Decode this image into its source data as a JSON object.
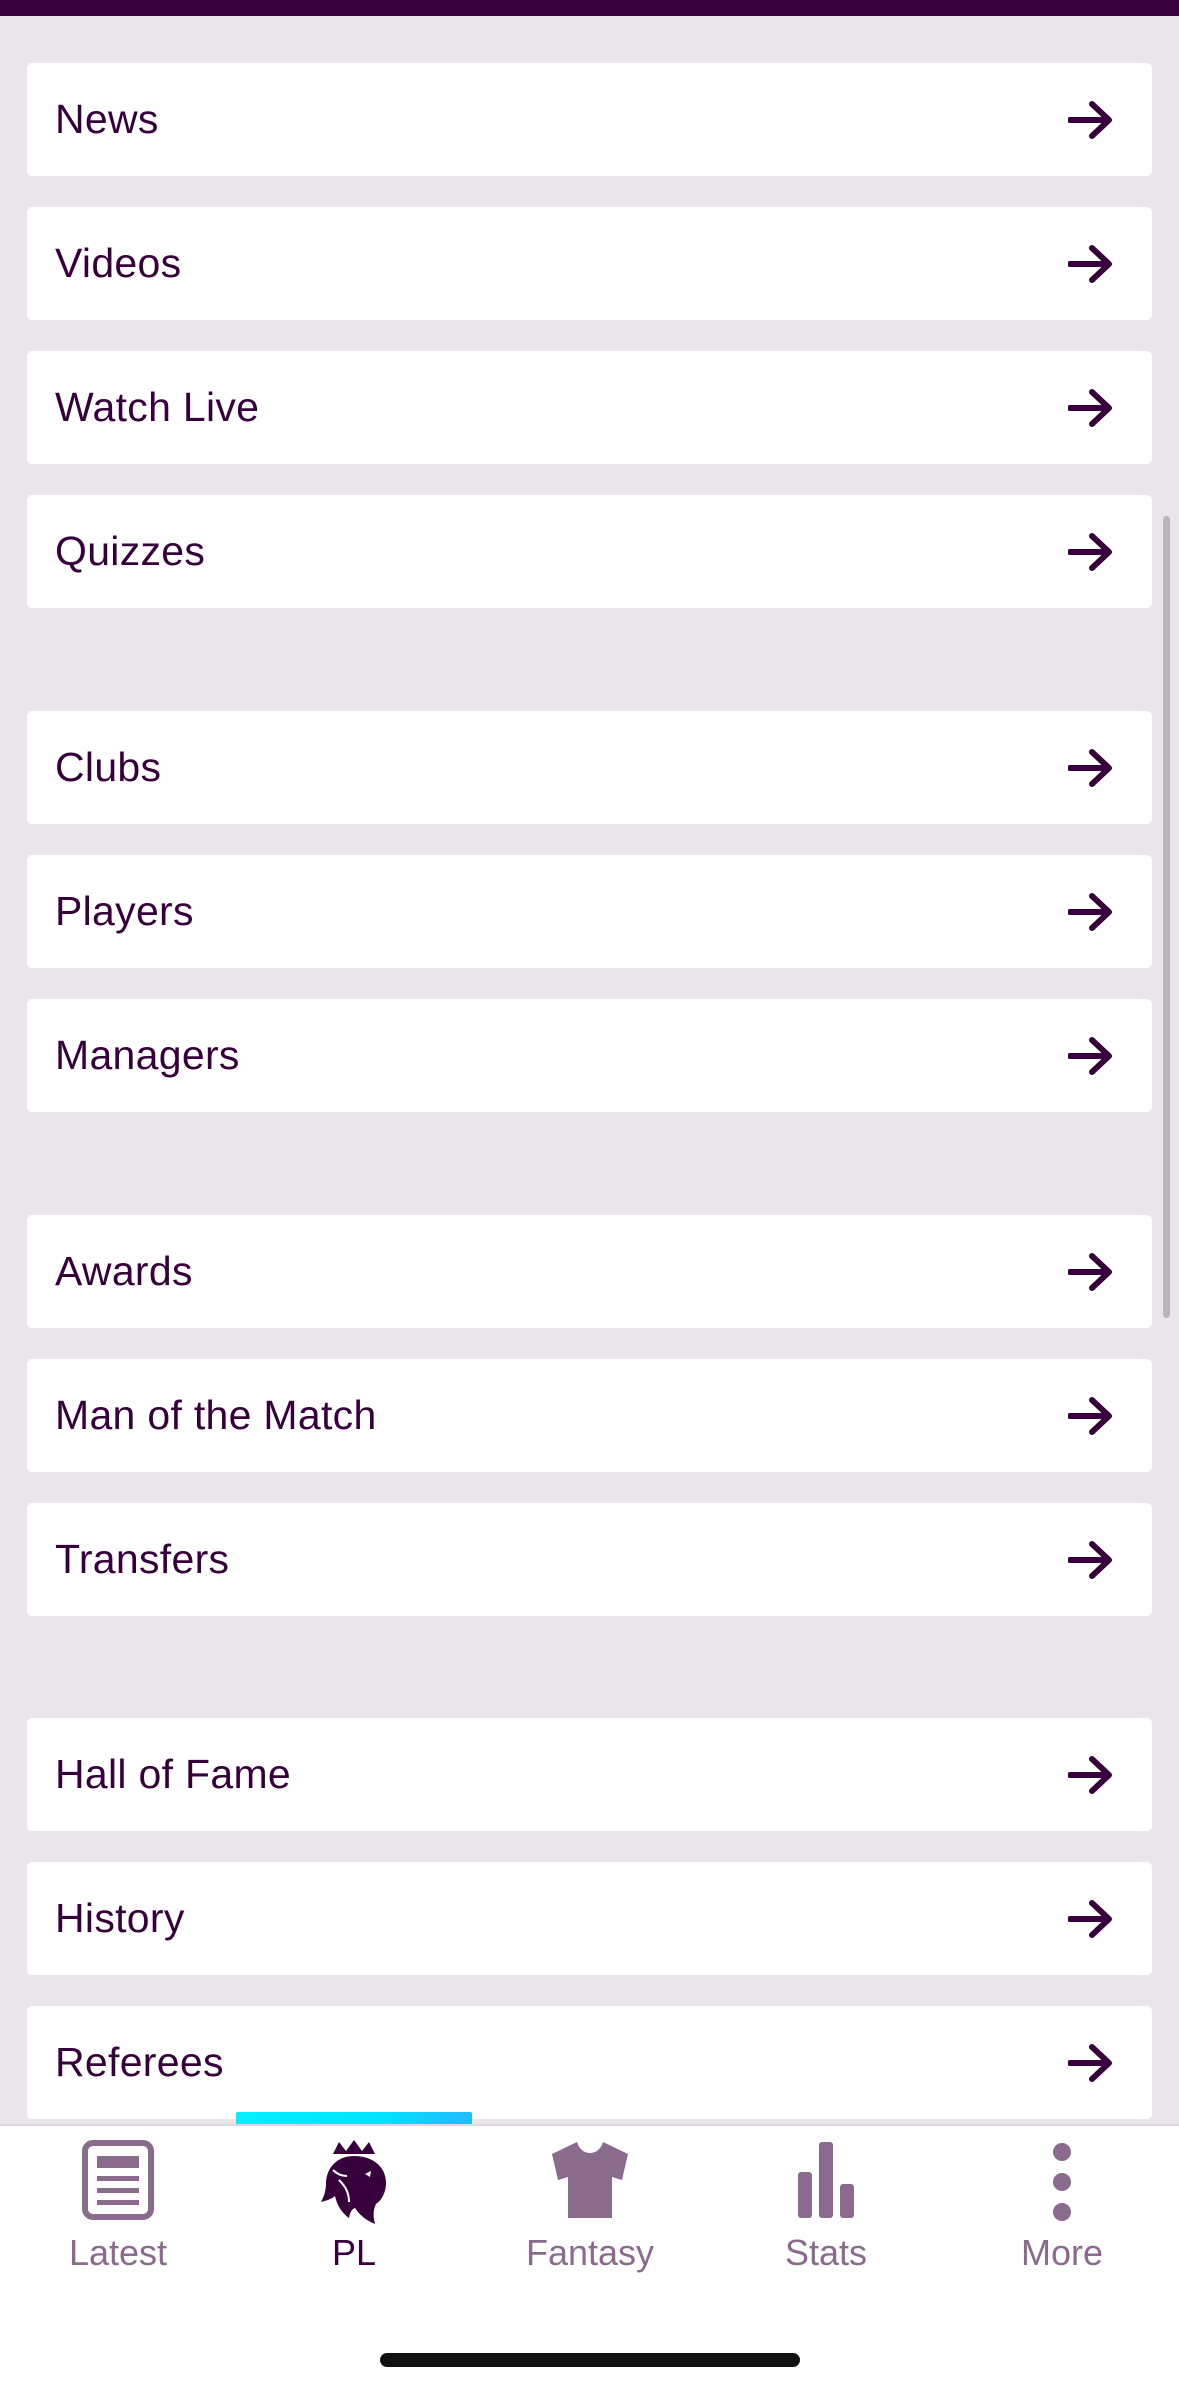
{
  "menu": {
    "items": [
      {
        "label": "News"
      },
      {
        "label": "Videos"
      },
      {
        "label": "Watch Live"
      },
      {
        "label": "Quizzes"
      },
      {
        "label": "Clubs"
      },
      {
        "label": "Players"
      },
      {
        "label": "Managers"
      },
      {
        "label": "Awards"
      },
      {
        "label": "Man of the Match"
      },
      {
        "label": "Transfers"
      },
      {
        "label": "Hall of Fame"
      },
      {
        "label": "History"
      },
      {
        "label": "Referees"
      }
    ],
    "arrow_icon": "arrow-right-icon"
  },
  "tabs": [
    {
      "label": "Latest",
      "icon": "news-article-icon",
      "active": false
    },
    {
      "label": "PL",
      "icon": "premier-league-lion-icon",
      "active": true
    },
    {
      "label": "Fantasy",
      "icon": "shirt-icon",
      "active": false
    },
    {
      "label": "Stats",
      "icon": "bar-chart-icon",
      "active": false
    },
    {
      "label": "More",
      "icon": "more-vertical-icon",
      "active": false
    }
  ],
  "colors": {
    "brand_purple": "#37003c",
    "background": "#e9e5ea",
    "card": "#ffffff",
    "inactive_tab": "#8a6b8d",
    "indicator_cyan": "#00e4ff"
  }
}
